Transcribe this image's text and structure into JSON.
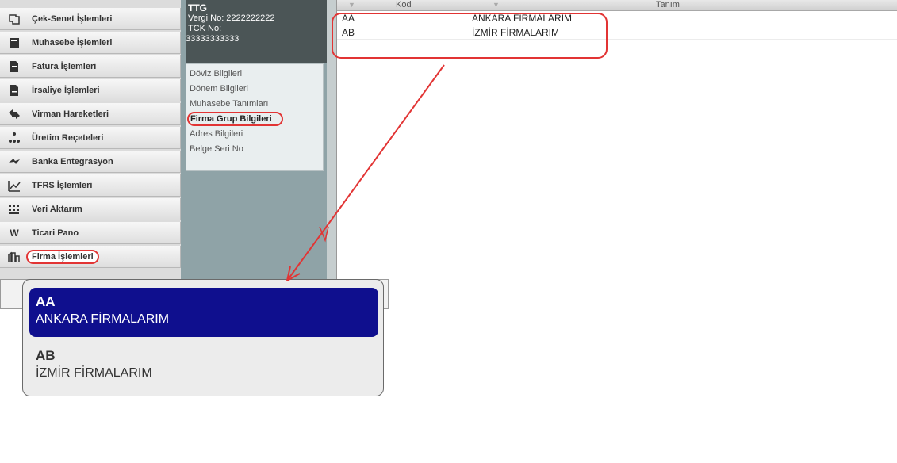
{
  "sidebar": {
    "items": [
      {
        "label": "Çek-Senet İşlemleri",
        "icon": "document-stack-icon"
      },
      {
        "label": "Muhasebe İşlemleri",
        "icon": "calculator-icon"
      },
      {
        "label": "Fatura İşlemleri",
        "icon": "invoice-icon"
      },
      {
        "label": "İrsaliye İşlemleri",
        "icon": "waybill-icon"
      },
      {
        "label": "Virman Hareketleri",
        "icon": "transfer-arrows-icon"
      },
      {
        "label": "Üretim Reçeteleri",
        "icon": "recipe-tree-icon"
      },
      {
        "label": "Banka Entegrasyon",
        "icon": "bank-exchange-icon"
      },
      {
        "label": "TFRS İşlemleri",
        "icon": "chart-icon"
      },
      {
        "label": "Veri Aktarım",
        "icon": "data-transfer-icon"
      },
      {
        "label": "Ticari Pano",
        "icon": "w-logo-icon"
      },
      {
        "label": "Firma İşlemleri",
        "icon": "buildings-icon"
      }
    ]
  },
  "company": {
    "name": "TTG",
    "vergi": "Vergi No: 2222222222",
    "tck_label": "TCK No:",
    "tck_value": "33333333333",
    "menu": [
      "Döviz Bilgileri",
      "Dönem Bilgileri",
      "Muhasebe Tanımları",
      "Firma Grup Bilgileri",
      "Adres Bilgileri",
      "Belge Seri No"
    ]
  },
  "grid": {
    "columns": [
      "Kod",
      "Tanım"
    ],
    "rows": [
      {
        "kod": "AA",
        "tanim": "ANKARA FİRMALARIM"
      },
      {
        "kod": "AB",
        "tanim": "İZMİR FİRMALARIM"
      }
    ]
  },
  "popup": {
    "items": [
      {
        "code": "AA",
        "name": "ANKARA FİRMALARIM"
      },
      {
        "code": "AB",
        "name": "İZMİR FİRMALARIM"
      }
    ]
  },
  "colors": {
    "accent_red": "#e23434",
    "selection_blue": "#0f0f8e",
    "company_header": "#4b5556"
  }
}
